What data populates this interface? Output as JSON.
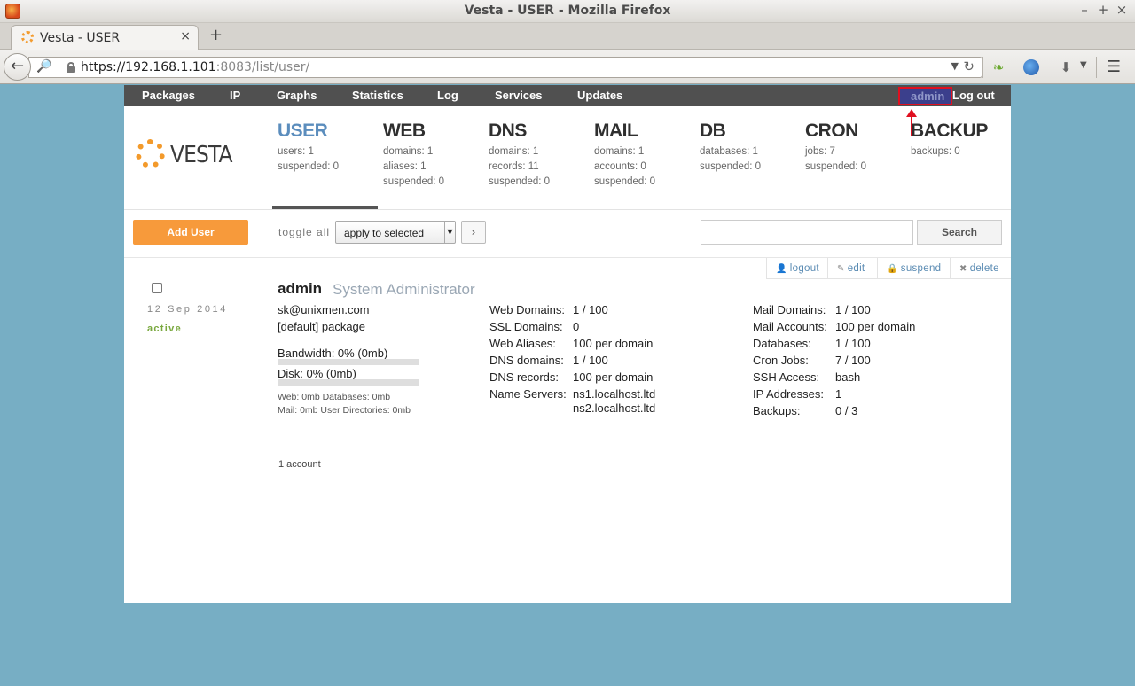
{
  "window": {
    "title": "Vesta - USER - Mozilla Firefox"
  },
  "browser": {
    "tab_title": "Vesta - USER",
    "url_host": "https://192.168.1.101",
    "url_rest": ":8083/list/user/"
  },
  "topmenu": {
    "items": [
      "Packages",
      "IP",
      "Graphs",
      "Statistics",
      "Log",
      "Services",
      "Updates"
    ],
    "user": "admin",
    "logout": "Log out"
  },
  "logo": {
    "text": "VESTA"
  },
  "stats": [
    {
      "head": "USER",
      "lines": [
        "users: 1",
        "suspended: 0"
      ]
    },
    {
      "head": "WEB",
      "lines": [
        "domains: 1",
        "aliases: 1",
        "suspended: 0"
      ]
    },
    {
      "head": "DNS",
      "lines": [
        "domains: 1",
        "records: 11",
        "suspended: 0"
      ]
    },
    {
      "head": "MAIL",
      "lines": [
        "domains: 1",
        "accounts: 0",
        "suspended: 0"
      ]
    },
    {
      "head": "DB",
      "lines": [
        "databases: 1",
        "suspended: 0"
      ]
    },
    {
      "head": "CRON",
      "lines": [
        "jobs: 7",
        "suspended: 0"
      ]
    },
    {
      "head": "BACKUP",
      "lines": [
        "backups: 0"
      ]
    }
  ],
  "toolbar": {
    "add_user": "Add User",
    "toggle_all": "toggle all",
    "bulk_selected": "apply to selected",
    "go": "›",
    "search_placeholder": "",
    "search": "Search"
  },
  "actions": {
    "logout": "logout",
    "edit": "edit",
    "suspend": "suspend",
    "delete": "delete"
  },
  "user": {
    "date": "12 Sep 2014",
    "status": "active",
    "name": "admin",
    "fullname": "System Administrator",
    "email": "sk@unixmen.com",
    "package": "[default] package",
    "bandwidth": "Bandwidth: 0% (0mb)",
    "bandwidth_fraction": 0,
    "disk": "Disk: 0% (0mb)",
    "disk_fraction": 0,
    "usage_line1": "Web: 0mb Databases: 0mb",
    "usage_line2": "Mail: 0mb  User Directories: 0mb",
    "col1": [
      {
        "k": "Web Domains:",
        "v": "1 / 100"
      },
      {
        "k": "SSL Domains:",
        "v": "0"
      },
      {
        "k": "Web Aliases:",
        "v": "100 per domain"
      },
      {
        "k": "DNS domains:",
        "v": "1 / 100"
      },
      {
        "k": "DNS records:",
        "v": "100 per domain"
      },
      {
        "k": "Name Servers:",
        "v": "ns1.localhost.ltd"
      }
    ],
    "ns2": "ns2.localhost.ltd",
    "col2": [
      {
        "k": "Mail Domains:",
        "v": "1 / 100"
      },
      {
        "k": "Mail Accounts:",
        "v": "100 per domain"
      },
      {
        "k": "Databases:",
        "v": "1 / 100"
      },
      {
        "k": "Cron Jobs:",
        "v": "7 / 100"
      },
      {
        "k": "SSH Access:",
        "v": "bash"
      },
      {
        "k": "IP Addresses:",
        "v": "1"
      },
      {
        "k": "Backups:",
        "v": "0 / 3"
      }
    ]
  },
  "footer": {
    "count": "1 account"
  },
  "colors": {
    "accent": "#f79a3b",
    "active_tab": "#5b8dbd",
    "menu_bg": "#505050",
    "status_active": "#79a83e"
  }
}
